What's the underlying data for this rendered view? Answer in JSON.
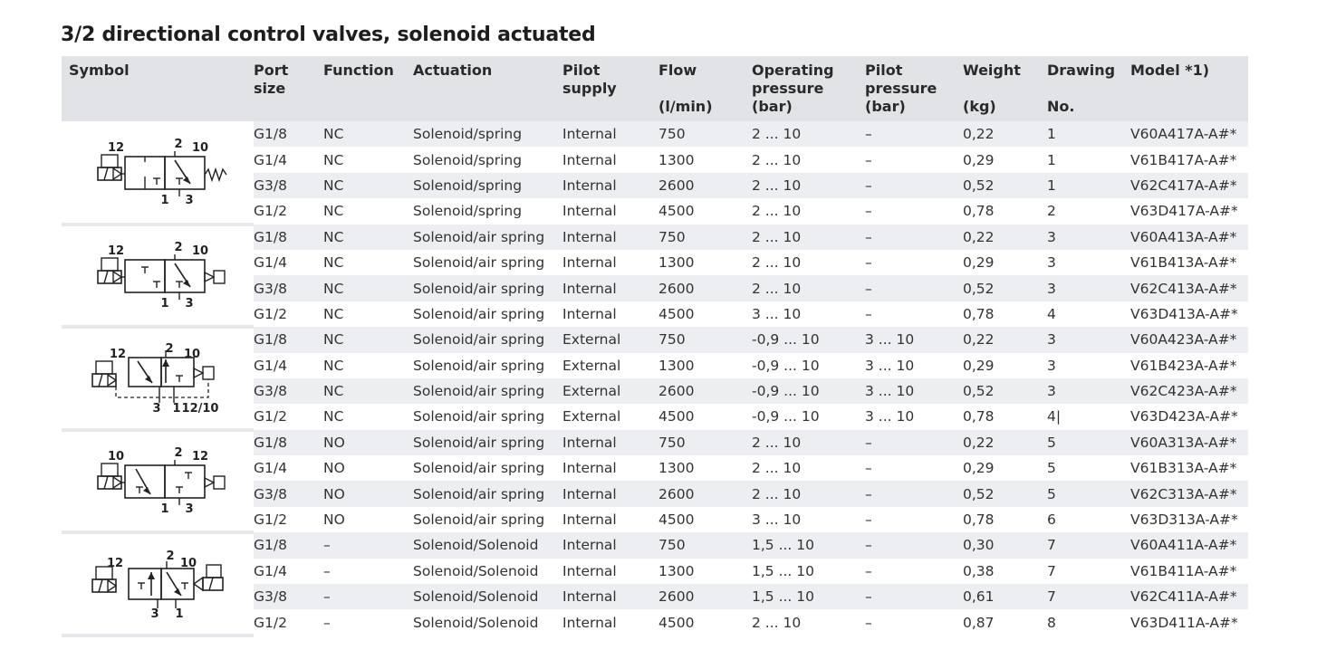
{
  "title": "3/2 directional control valves, solenoid actuated",
  "headers": {
    "symbol": "Symbol",
    "port_size": [
      "Port",
      "size"
    ],
    "function": "Function",
    "actuation": "Actuation",
    "pilot_supply": [
      "Pilot",
      "supply"
    ],
    "flow": [
      "Flow",
      "(l/min)"
    ],
    "operating_pressure": [
      "Operating",
      "pressure",
      "(bar)"
    ],
    "pilot_pressure": [
      "Pilot",
      "pressure",
      "(bar)"
    ],
    "weight": [
      "Weight",
      "(kg)"
    ],
    "drawing": [
      "Drawing",
      "No."
    ],
    "model": "Model *1)"
  },
  "groups": [
    {
      "symbol_icon": "valve-symbol-nc-spring",
      "symbol_labels": [
        "12",
        "2",
        "10",
        "1",
        "3"
      ],
      "rows": [
        [
          "G1/8",
          "NC",
          "Solenoid/spring",
          "Internal",
          "750",
          "2 ... 10",
          "–",
          "0,22",
          "1",
          "V60A417A-A#*"
        ],
        [
          "G1/4",
          "NC",
          "Solenoid/spring",
          "Internal",
          "1300",
          "2 ... 10",
          "–",
          "0,29",
          "1",
          "V61B417A-A#*"
        ],
        [
          "G3/8",
          "NC",
          "Solenoid/spring",
          "Internal",
          "2600",
          "2 ... 10",
          "–",
          "0,52",
          "1",
          "V62C417A-A#*"
        ],
        [
          "G1/2",
          "NC",
          "Solenoid/spring",
          "Internal",
          "4500",
          "2 ... 10",
          "–",
          "0,78",
          "2",
          "V63D417A-A#*"
        ]
      ]
    },
    {
      "symbol_icon": "valve-symbol-nc-air-spring",
      "symbol_labels": [
        "12",
        "2",
        "10",
        "1",
        "3"
      ],
      "rows": [
        [
          "G1/8",
          "NC",
          "Solenoid/air spring",
          "Internal",
          "750",
          "2 ... 10",
          "–",
          "0,22",
          "3",
          "V60A413A-A#*"
        ],
        [
          "G1/4",
          "NC",
          "Solenoid/air spring",
          "Internal",
          "1300",
          "2 ... 10",
          "–",
          "0,29",
          "3",
          "V61B413A-A#*"
        ],
        [
          "G3/8",
          "NC",
          "Solenoid/air spring",
          "Internal",
          "2600",
          "2 ... 10",
          "–",
          "0,52",
          "3",
          "V62C413A-A#*"
        ],
        [
          "G1/2",
          "NC",
          "Solenoid/air spring",
          "Internal",
          "4500",
          "3 ... 10",
          "–",
          "0,78",
          "4",
          "V63D413A-A#*"
        ]
      ]
    },
    {
      "symbol_icon": "valve-symbol-nc-external-pilot",
      "symbol_labels": [
        "12",
        "2",
        "10",
        "3",
        "1",
        "12/10"
      ],
      "rows": [
        [
          "G1/8",
          "NC",
          "Solenoid/air spring",
          "External",
          "750",
          "-0,9 ... 10",
          "3 ... 10",
          "0,22",
          "3",
          "V60A423A-A#*"
        ],
        [
          "G1/4",
          "NC",
          "Solenoid/air spring",
          "External",
          "1300",
          "-0,9 ... 10",
          "3 ... 10",
          "0,29",
          "3",
          "V61B423A-A#*"
        ],
        [
          "G3/8",
          "NC",
          "Solenoid/air spring",
          "External",
          "2600",
          "-0,9 ... 10",
          "3 ... 10",
          "0,52",
          "3",
          "V62C423A-A#*"
        ],
        [
          "G1/2",
          "NC",
          "Solenoid/air spring",
          "External",
          "4500",
          "-0,9 ... 10",
          "3 ... 10",
          "0,78",
          "4|",
          "V63D423A-A#*"
        ]
      ]
    },
    {
      "symbol_icon": "valve-symbol-no-air-spring",
      "symbol_labels": [
        "10",
        "2",
        "12",
        "1",
        "3"
      ],
      "rows": [
        [
          "G1/8",
          "NO",
          "Solenoid/air spring",
          "Internal",
          "750",
          "2 ... 10",
          "–",
          "0,22",
          "5",
          "V60A313A-A#*"
        ],
        [
          "G1/4",
          "NO",
          "Solenoid/air spring",
          "Internal",
          "1300",
          "2 ... 10",
          "–",
          "0,29",
          "5",
          "V61B313A-A#*"
        ],
        [
          "G3/8",
          "NO",
          "Solenoid/air spring",
          "Internal",
          "2600",
          "2 ... 10",
          "–",
          "0,52",
          "5",
          "V62C313A-A#*"
        ],
        [
          "G1/2",
          "NO",
          "Solenoid/air spring",
          "Internal",
          "4500",
          "3 ... 10",
          "–",
          "0,78",
          "6",
          "V63D313A-A#*"
        ]
      ]
    },
    {
      "symbol_icon": "valve-symbol-double-solenoid",
      "symbol_labels": [
        "12",
        "2",
        "10",
        "3",
        "1"
      ],
      "rows": [
        [
          "G1/8",
          "–",
          "Solenoid/Solenoid",
          "Internal",
          "750",
          "1,5 ... 10",
          "–",
          "0,30",
          "7",
          "V60A411A-A#*"
        ],
        [
          "G1/4",
          "–",
          "Solenoid/Solenoid",
          "Internal",
          "1300",
          "1,5 ... 10",
          "–",
          "0,38",
          "7",
          "V61B411A-A#*"
        ],
        [
          "G3/8",
          "–",
          "Solenoid/Solenoid",
          "Internal",
          "2600",
          "1,5 ... 10",
          "–",
          "0,61",
          "7",
          "V62C411A-A#*"
        ],
        [
          "G1/2",
          "–",
          "Solenoid/Solenoid",
          "Internal",
          "4500",
          "2 ... 10",
          "–",
          "0,87",
          "8",
          "V63D411A-A#*"
        ]
      ]
    }
  ]
}
